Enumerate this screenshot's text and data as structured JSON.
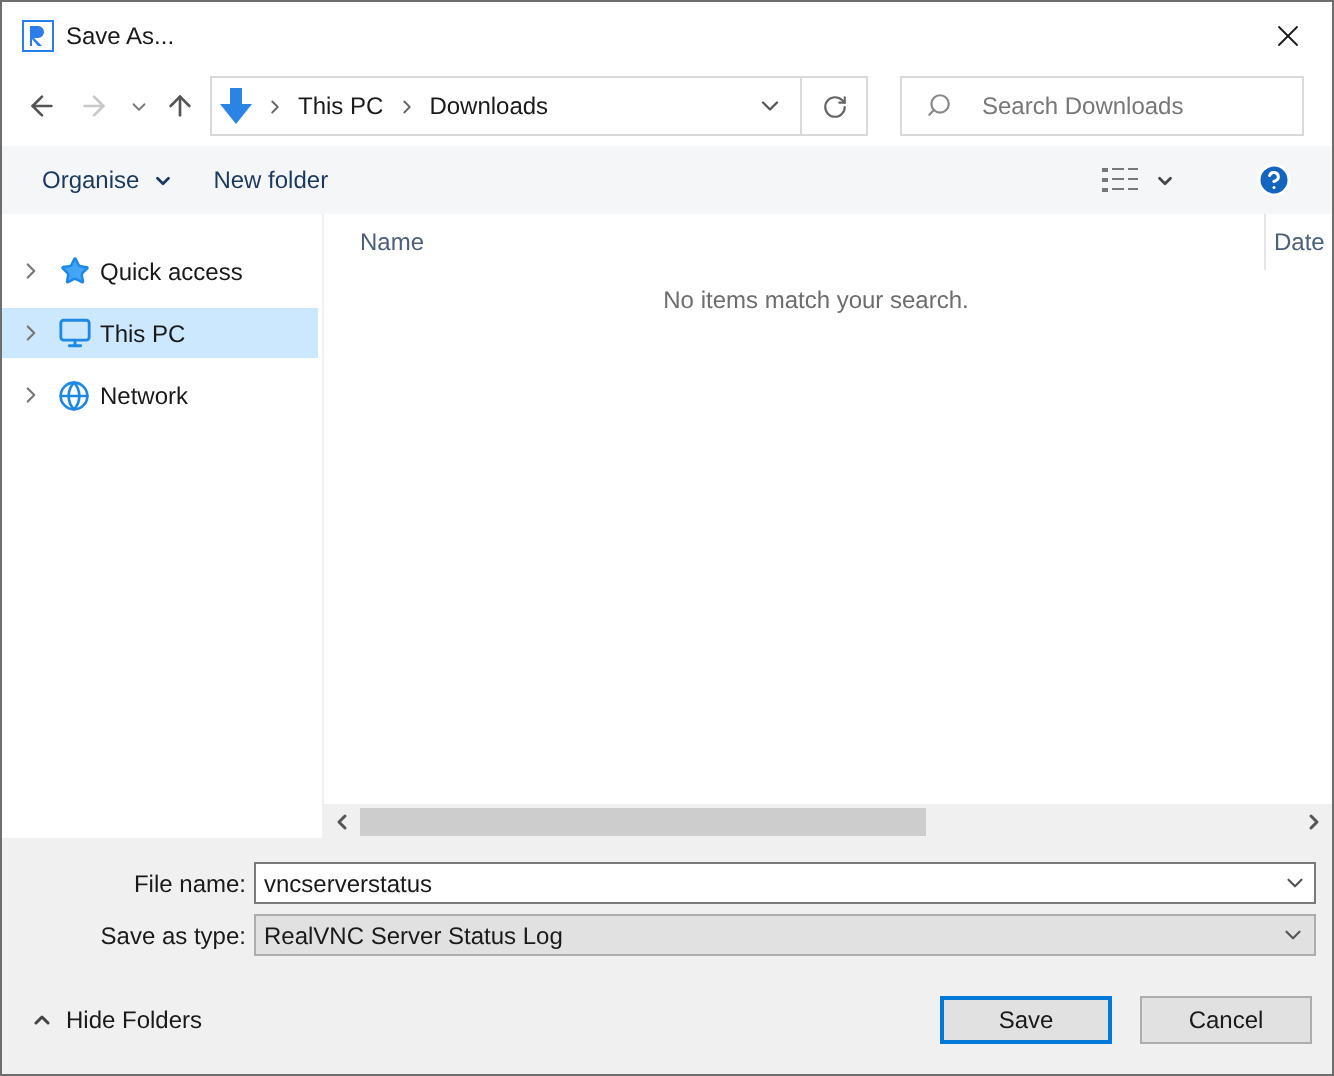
{
  "window": {
    "title": "Save As..."
  },
  "address": {
    "path": [
      {
        "label": "This PC"
      },
      {
        "label": "Downloads"
      }
    ]
  },
  "search": {
    "placeholder": "Search Downloads"
  },
  "toolbar": {
    "items": [
      {
        "label": "Organise",
        "kind": "menu"
      },
      {
        "label": "New folder",
        "kind": "plain"
      }
    ]
  },
  "sidebar": {
    "items": [
      {
        "label": "Quick access",
        "kind": "star",
        "selected": false
      },
      {
        "label": "This PC",
        "kind": "pc",
        "selected": true
      },
      {
        "label": "Network",
        "kind": "network",
        "selected": false
      }
    ]
  },
  "table": {
    "columns": [
      "Name",
      "Date"
    ],
    "empty_message": "No items match your search."
  },
  "fields": [
    {
      "label": "File name:",
      "value": "vncserverstatus",
      "kind": "combo"
    },
    {
      "label": "Save as type:",
      "value": "RealVNC Server Status Log",
      "kind": "select"
    }
  ],
  "hide_folders": "Hide Folders",
  "buttons": [
    {
      "label": "Save",
      "default": true
    },
    {
      "label": "Cancel",
      "default": false
    }
  ]
}
